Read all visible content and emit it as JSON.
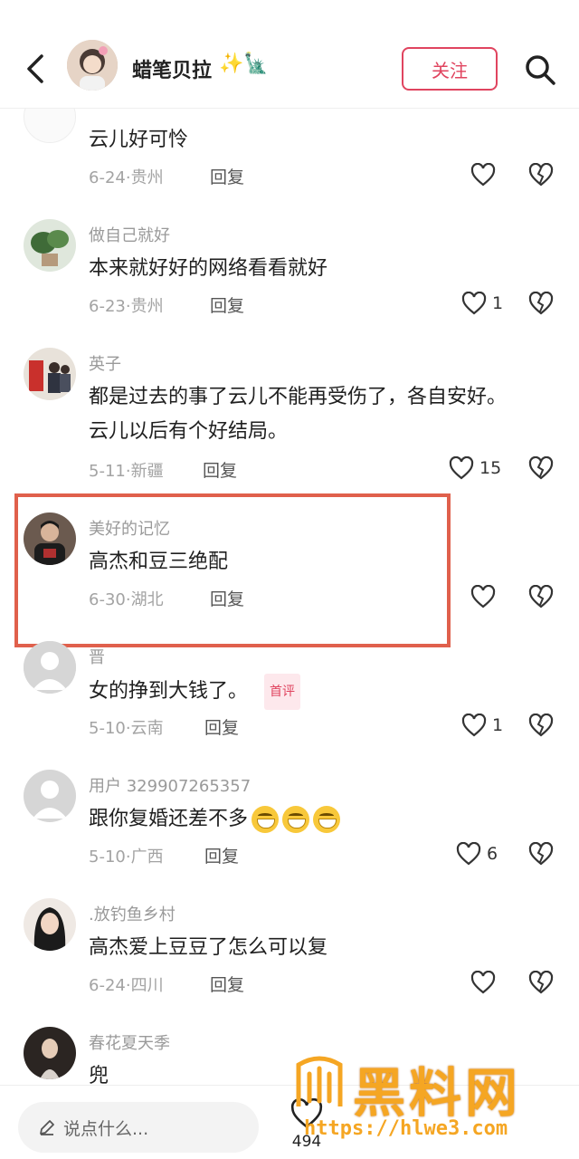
{
  "header": {
    "title": "蜡笔贝拉",
    "title_suffix": "✨🗽",
    "follow_label": "关注"
  },
  "comments": [
    {
      "name": "",
      "text": "云儿好可怜",
      "date": "6-24",
      "region": "贵州",
      "reply": "回复",
      "likes": ""
    },
    {
      "name": "做自己就好",
      "text": "本来就好好的网络看看就好",
      "date": "6-23",
      "region": "贵州",
      "reply": "回复",
      "likes": "1"
    },
    {
      "name": "英子",
      "text_line1": "都是过去的事了云儿不能再受伤了，各自安好。",
      "text_line2": "云儿以后有个好结局。",
      "date": "5-11",
      "region": "新疆",
      "reply": "回复",
      "likes": "15"
    },
    {
      "name": "美好的记忆",
      "text": "高杰和豆三绝配",
      "date": "6-30",
      "region": "湖北",
      "reply": "回复",
      "likes": ""
    },
    {
      "name": "晋",
      "text": "女的挣到大钱了。",
      "badge": "首评",
      "date": "5-10",
      "region": "云南",
      "reply": "回复",
      "likes": "1"
    },
    {
      "name": "用户 329907265357",
      "text": "跟你复婚还差不多",
      "date": "5-10",
      "region": "广西",
      "reply": "回复",
      "likes": "6"
    },
    {
      "name": ".放钓鱼乡村",
      "text": "高杰爱上豆豆了怎么可以复",
      "date": "6-24",
      "region": "四川",
      "reply": "回复",
      "likes": ""
    },
    {
      "name": "春花夏天季",
      "text": "兜"
    }
  ],
  "bottom": {
    "input_placeholder": "说点什么...",
    "like_count": "494"
  },
  "watermark": {
    "title": "黑料网",
    "url": "https://hlwe3.com"
  },
  "colors": {
    "accent": "#e0445f",
    "highlight_border": "#e0604c",
    "watermark": "#f5a623"
  },
  "icons": [
    "back-icon",
    "search-icon",
    "heart-icon",
    "broken-heart-icon",
    "pencil-icon",
    "default-avatar-icon",
    "grin-emoji-icon"
  ]
}
